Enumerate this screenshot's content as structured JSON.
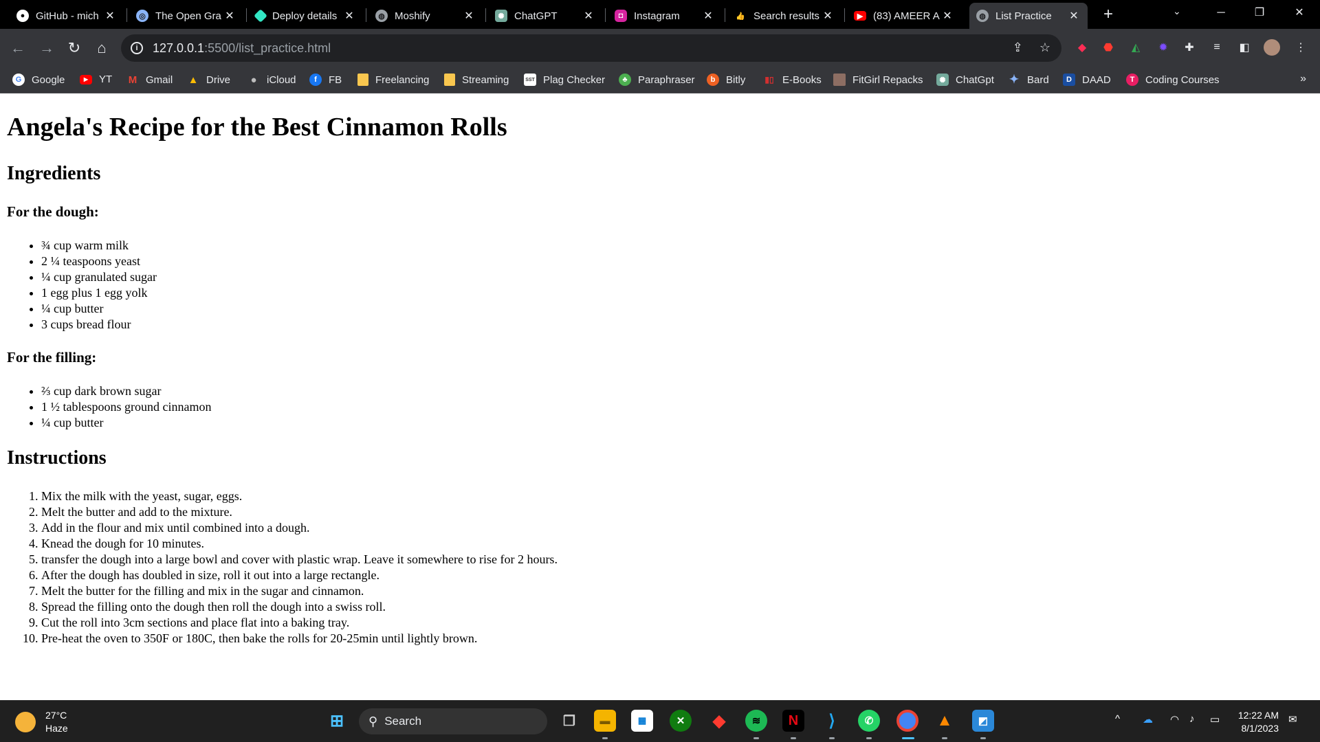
{
  "browser": {
    "tabs": [
      {
        "title": "GitHub - mich",
        "icon": "github-icon"
      },
      {
        "title": "The Open Gra",
        "icon": "open-graph-icon"
      },
      {
        "title": "Deploy details",
        "icon": "netlify-icon"
      },
      {
        "title": "Moshify",
        "icon": "globe-icon"
      },
      {
        "title": "ChatGPT",
        "icon": "chatgpt-icon"
      },
      {
        "title": "Instagram",
        "icon": "instagram-icon"
      },
      {
        "title": "Search results",
        "icon": "thumbs-up-icon"
      },
      {
        "title": "(83) AMEER A",
        "icon": "youtube-icon"
      },
      {
        "title": "List Practice",
        "icon": "globe-icon"
      }
    ],
    "active_tab_index": 8,
    "url": {
      "host": "127.0.0.1",
      "path": ":5500/list_practice.html"
    },
    "bookmarks": [
      "Google",
      "YT",
      "Gmail",
      "Drive",
      "iCloud",
      "FB",
      "Freelancing",
      "Streaming",
      "Plag Checker",
      "Paraphraser",
      "Bitly",
      "E-Books",
      "FitGirl Repacks",
      "ChatGpt",
      "Bard",
      "DAAD",
      "Coding Courses"
    ],
    "bookmark_more": "»"
  },
  "page": {
    "title": "Angela's Recipe for the Best Cinnamon Rolls",
    "ingredients_heading": "Ingredients",
    "dough_heading": "For the dough:",
    "dough_items": [
      "¾ cup warm milk",
      "2 ¼ teaspoons yeast",
      "¼ cup granulated sugar",
      "1 egg plus 1 egg yolk",
      "¼ cup butter",
      "3 cups bread flour"
    ],
    "filling_heading": "For the filling:",
    "filling_items": [
      "⅔ cup dark brown sugar",
      "1 ½ tablespoons ground cinnamon",
      "¼ cup butter"
    ],
    "instructions_heading": "Instructions",
    "instructions": [
      "Mix the milk with the yeast, sugar, eggs.",
      "Melt the butter and add to the mixture.",
      "Add in the flour and mix until combined into a dough.",
      "Knead the dough for 10 minutes.",
      "transfer the dough into a large bowl and cover with plastic wrap. Leave it somewhere to rise for 2 hours.",
      "After the dough has doubled in size, roll it out into a large rectangle.",
      "Melt the butter for the filling and mix in the sugar and cinnamon.",
      "Spread the filling onto the dough then roll the dough into a swiss roll.",
      "Cut the roll into 3cm sections and place flat into a baking tray.",
      "Pre-heat the oven to 350F or 180C, then bake the rolls for 20-25min until lightly brown."
    ]
  },
  "taskbar": {
    "weather_temp": "27°C",
    "weather_desc": "Haze",
    "search_label": "Search",
    "time": "12:22 AM",
    "date": "8/1/2023"
  }
}
